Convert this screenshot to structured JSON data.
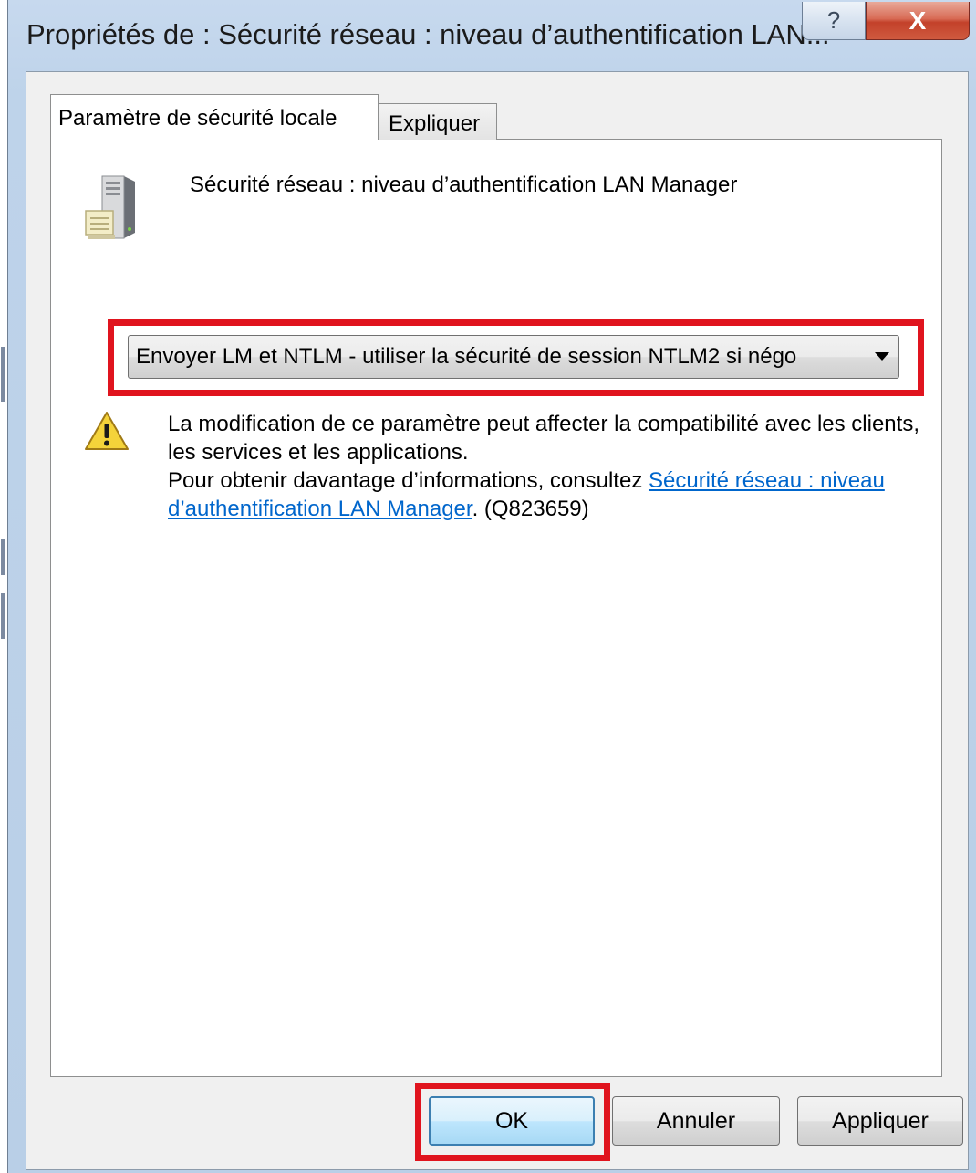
{
  "window": {
    "title": "Propriétés de : Sécurité réseau : niveau d’authentification LAN...",
    "help_glyph": "?",
    "close_glyph": "X"
  },
  "tabs": [
    {
      "label": "Paramètre de sécurité locale",
      "active": true
    },
    {
      "label": "Expliquer",
      "active": false
    }
  ],
  "policy": {
    "name": "Sécurité réseau : niveau d’authentification LAN Manager",
    "selected_value": "Envoyer LM et NTLM - utiliser la sécurité de session NTLM2 si négo"
  },
  "warning": {
    "line1": "La modification de ce paramètre peut affecter la compatibilité avec les clients, les services et les applications.",
    "line2_prefix": "Pour obtenir davantage d’informations, consultez ",
    "link_text": "Sécurité réseau : niveau d’authentification LAN Manager",
    "line2_suffix": ". (Q823659)"
  },
  "buttons": {
    "ok": "OK",
    "cancel": "Annuler",
    "apply": "Appliquer"
  },
  "colors": {
    "highlight": "#e0141e",
    "link": "#0066cc"
  }
}
